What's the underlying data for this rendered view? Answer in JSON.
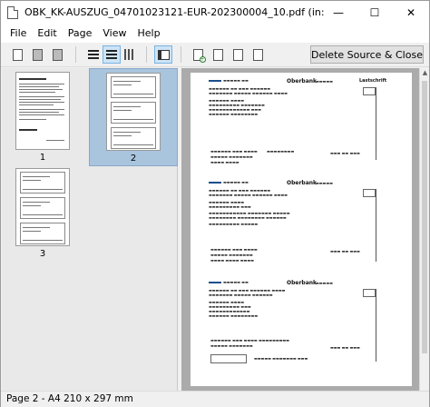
{
  "window": {
    "title": "OBK_KK-AUSZUG_04701023121-EUR-202300004_10.pdf   (in: D:\\PROJEKTE\\x...",
    "controls": {
      "minimize": "—",
      "maximize": "☐",
      "close": "✕"
    }
  },
  "menu": {
    "items": [
      {
        "label": "File"
      },
      {
        "label": "Edit"
      },
      {
        "label": "Page"
      },
      {
        "label": "View"
      },
      {
        "label": "Help"
      }
    ]
  },
  "toolbar": {
    "delete_label": "Delete Source & Close"
  },
  "thumbnails": [
    {
      "number": "1",
      "selected": false
    },
    {
      "number": "2",
      "selected": true
    },
    {
      "number": "3",
      "selected": false
    }
  ],
  "preview": {
    "bank_name": "Oberbank",
    "heading": "Lastschrift",
    "statement_count": 3
  },
  "status": {
    "text": "Page 2  -  A4 210 x 297 mm"
  },
  "colors": {
    "selection": "#a9c4dd",
    "view_background": "#ababab",
    "active_tool": "#cce4f7"
  }
}
